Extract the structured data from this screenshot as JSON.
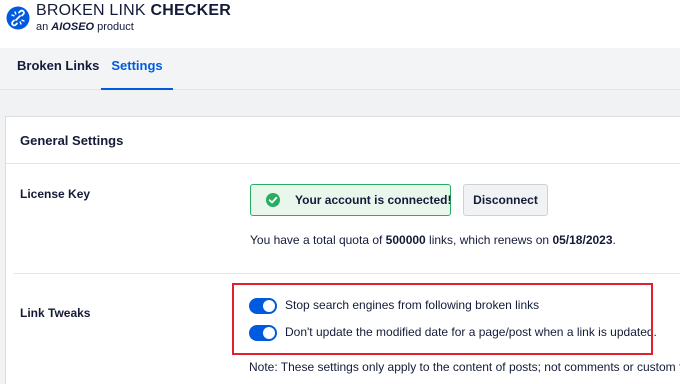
{
  "brand": {
    "title_light": "BROKEN LINK ",
    "title_bold": "CHECKER",
    "sub_prefix": "an ",
    "sub_brand": "AIOSEO",
    "sub_suffix": " product"
  },
  "tabs": [
    {
      "label": "Broken Links",
      "active": false
    },
    {
      "label": "Settings",
      "active": true
    }
  ],
  "settings": {
    "title": "General Settings",
    "license": {
      "label": "License Key",
      "status_text": "Your account is connected!",
      "disconnect_label": "Disconnect",
      "quota_prefix": "You have a total quota of ",
      "quota_links": "500000",
      "quota_middle": " links, which renews on ",
      "quota_date": "05/18/2023",
      "quota_suffix": "."
    },
    "link_tweaks": {
      "label": "Link Tweaks",
      "options": [
        {
          "label": "Stop search engines from following broken links",
          "enabled": true
        },
        {
          "label": "Don't update the modified date for a page/post when a link is updated.",
          "enabled": true
        }
      ],
      "note": "Note: These settings only apply to the content of posts; not comments or custom fields."
    }
  },
  "colors": {
    "accent": "#005ae0",
    "success": "#27ae60",
    "highlight": "#e0212d"
  }
}
